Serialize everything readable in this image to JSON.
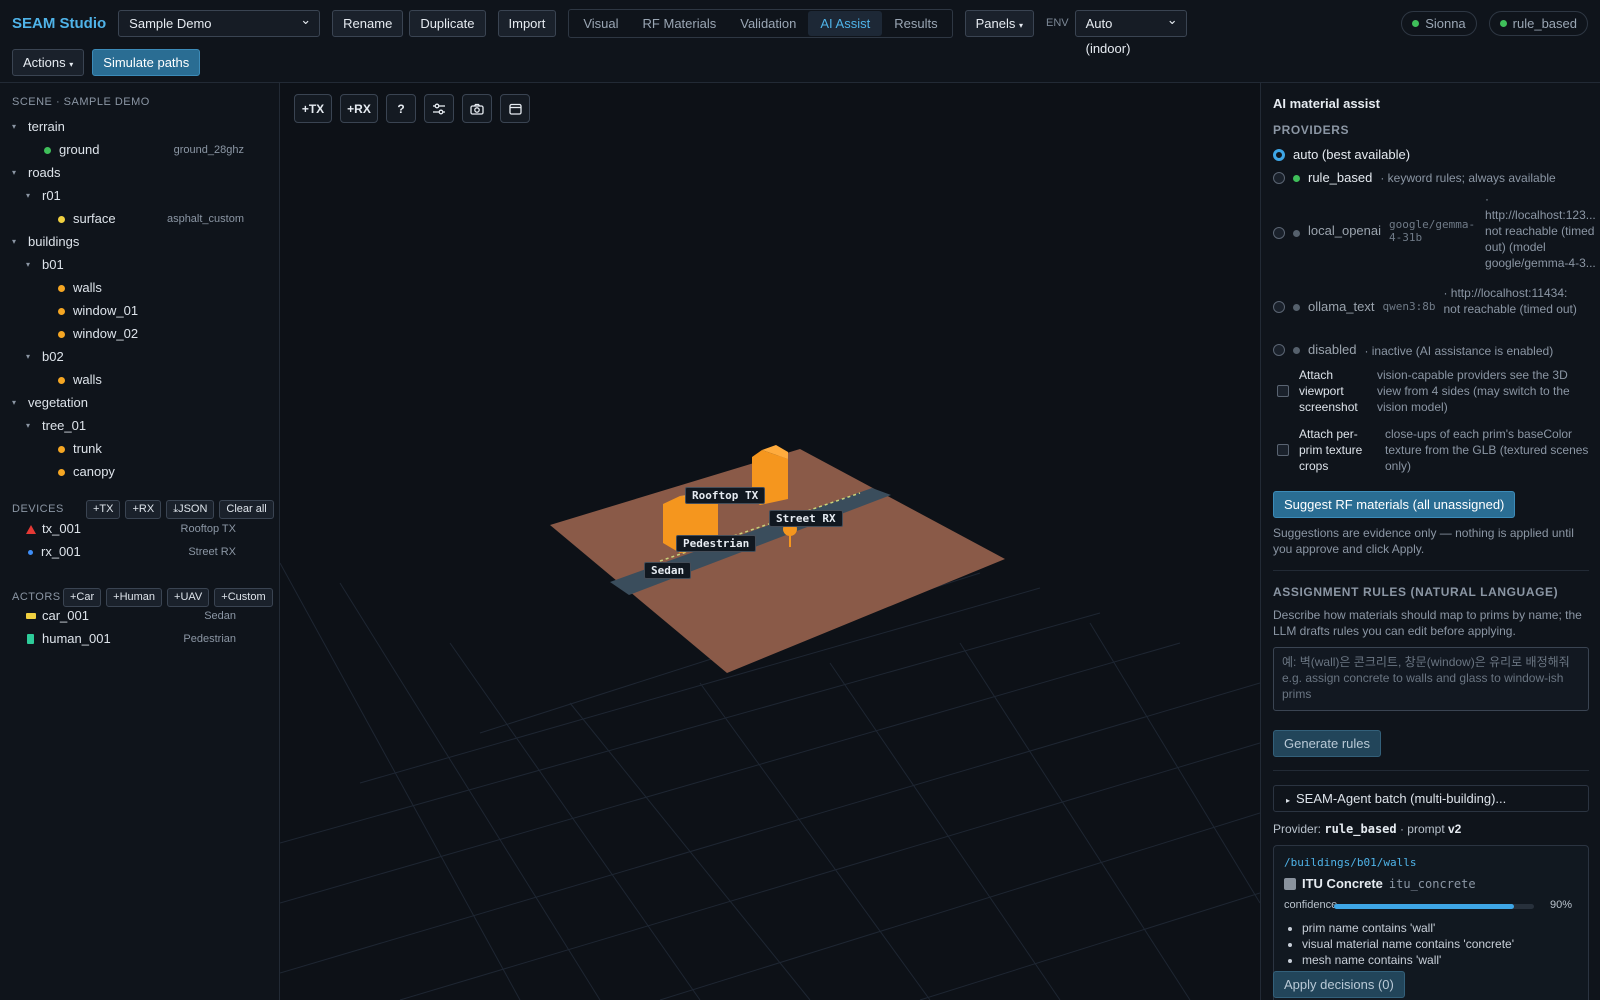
{
  "app": {
    "brand": "SEAM Studio",
    "scene_select": "Sample Demo",
    "buttons": {
      "rename": "Rename",
      "duplicate": "Duplicate",
      "import": "Import",
      "panels": "Panels",
      "actions": "Actions",
      "simulate": "Simulate paths"
    },
    "tabs": [
      {
        "label": "Visual"
      },
      {
        "label": "RF Materials"
      },
      {
        "label": "Validation"
      },
      {
        "label": "AI Assist"
      },
      {
        "label": "Results"
      }
    ],
    "env_label": "ENV",
    "env_select": "Auto (indoor)",
    "status": {
      "engine": "Sionna",
      "provider": "rule_based"
    }
  },
  "sidebar": {
    "scene_title": "SCENE · SAMPLE DEMO",
    "tree": {
      "terrain": "terrain",
      "ground": "ground",
      "ground_mat": "ground_28ghz",
      "roads": "roads",
      "r01": "r01",
      "surface": "surface",
      "surface_mat": "asphalt_custom",
      "buildings": "buildings",
      "b01": "b01",
      "walls": "walls",
      "window_01": "window_01",
      "window_02": "window_02",
      "b02": "b02",
      "walls_b02": "walls",
      "vegetation": "vegetation",
      "tree_01": "tree_01",
      "trunk": "trunk",
      "canopy": "canopy"
    },
    "devices_title": "DEVICES",
    "device_tools": {
      "tx": "+TX",
      "rx": "+RX",
      "json": "⤓JSON",
      "clear": "Clear all"
    },
    "devices": [
      {
        "id": "tx_001",
        "name": "Rooftop TX"
      },
      {
        "id": "rx_001",
        "name": "Street RX"
      }
    ],
    "actors_title": "ACTORS",
    "actor_tools": {
      "car": "+Car",
      "human": "+Human",
      "uav": "+UAV",
      "custom": "+Custom"
    },
    "actors": [
      {
        "id": "car_001",
        "name": "Sedan"
      },
      {
        "id": "human_001",
        "name": "Pedestrian"
      }
    ]
  },
  "viewport": {
    "tools": {
      "tx": "+TX",
      "rx": "+RX",
      "help": "?"
    },
    "labels": {
      "rooftop": "Rooftop TX",
      "street": "Street RX",
      "pedestrian": "Pedestrian",
      "sedan": "Sedan"
    },
    "colors": {
      "ground": "#8a5a48",
      "road": "#3a4d5c",
      "building": "#f5961e"
    }
  },
  "right": {
    "title": "AI material assist",
    "providers_head": "PROVIDERS",
    "providers": {
      "auto": "auto (best available)",
      "rule_name": "rule_based",
      "rule_desc": "· keyword rules; always available",
      "local_name": "local_openai",
      "local_model": "google/gemma-4-31b",
      "local_desc": "· http://localhost:123... not reachable (timed out) (model google/gemma-4-3...",
      "ollama_name": "ollama_text",
      "ollama_model": "qwen3:8b",
      "ollama_desc": "· http://localhost:11434: not reachable (timed out)",
      "disabled_name": "disabled",
      "disabled_desc": "· inactive (AI assistance is enabled)"
    },
    "attach_viewport": "Attach viewport screenshot",
    "attach_viewport_desc": "vision-capable providers see the 3D view from 4 sides (may switch to the vision model)",
    "attach_crops": "Attach per-prim texture crops",
    "attach_crops_desc": "close-ups of each prim's baseColor texture from the GLB (textured scenes only)",
    "suggest_btn": "Suggest RF materials (all unassigned)",
    "suggest_note": "Suggestions are evidence only — nothing is applied until you approve and click Apply.",
    "rules_head": "ASSIGNMENT RULES (NATURAL LANGUAGE)",
    "rules_desc": "Describe how materials should map to prims by name; the LLM drafts rules you can edit before applying.",
    "rules_placeholder_ko": "예: 벽(wall)은 콘크리트, 창문(window)은 유리로 배정해줘",
    "rules_placeholder_en": "e.g. assign concrete to walls and glass to window-ish prims",
    "generate_btn": "Generate rules",
    "batch": "SEAM-Agent batch (multi-building)...",
    "provider_line": {
      "prefix": "Provider:",
      "name": "rule_based",
      "sep": "· prompt",
      "version": "v2"
    },
    "card": {
      "path": "/buildings/b01/walls",
      "material": "ITU Concrete",
      "material_id": "itu_concrete",
      "conf_label": "confidence",
      "conf_value": 0.9,
      "conf_text": "90%",
      "reasons": [
        "prim name contains 'wall'",
        "visual material name contains 'concrete'",
        "mesh name contains 'wall'"
      ]
    },
    "apply_btn": "Apply decisions (0)"
  }
}
